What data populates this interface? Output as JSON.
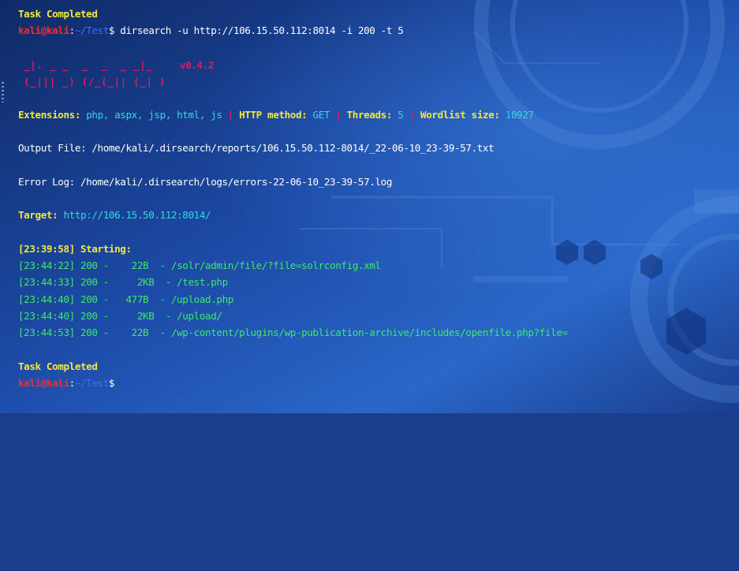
{
  "terminal": {
    "header_status": "Task Completed",
    "prompt1": {
      "user": "kali@kali",
      "sep": ":",
      "path": "~/Test",
      "sym": "$",
      "command": " dirsearch -u http://106.15.50.112:8014 -i 200 -t 5"
    },
    "logo": {
      "line1": "_|. _ _  _  _  _ _|_",
      "line2": "(_||| _) (/_(_|| (_| )",
      "version": "v0.4.2"
    },
    "config": {
      "ext_label": "Extensions:",
      "ext_value": "php, aspx, jsp, html, js",
      "sep": "|",
      "method_label": "HTTP method:",
      "method_value": "GET",
      "threads_label": "Threads:",
      "threads_value": "5",
      "wordlist_label": "Wordlist size:",
      "wordlist_value": "10927"
    },
    "output_file": "Output File: /home/kali/.dirsearch/reports/106.15.50.112-8014/_22-06-10_23-39-57.txt",
    "error_log": "Error Log: /home/kali/.dirsearch/logs/errors-22-06-10_23-39-57.log",
    "target_label": "Target:",
    "target_value": "http://106.15.50.112:8014/",
    "starting": "[23:39:58] Starting:",
    "results": [
      {
        "time": "[23:44:22]",
        "code": "200",
        "size": "   22B",
        "path": "/solr/admin/file/?file=solrconfig.xml"
      },
      {
        "time": "[23:44:33]",
        "code": "200",
        "size": "    2KB",
        "path": "/test.php"
      },
      {
        "time": "[23:44:40]",
        "code": "200",
        "size": "  477B",
        "path": "/upload.php"
      },
      {
        "time": "[23:44:40]",
        "code": "200",
        "size": "    2KB",
        "path": "/upload/"
      },
      {
        "time": "[23:44:53]",
        "code": "200",
        "size": "   22B",
        "path": "/wp-content/plugins/wp-publication-archive/includes/openfile.php?file="
      }
    ],
    "footer_status": "Task Completed",
    "prompt2": {
      "user": "kali@kali",
      "sep": ":",
      "path": "~/Test",
      "sym": "$"
    }
  }
}
